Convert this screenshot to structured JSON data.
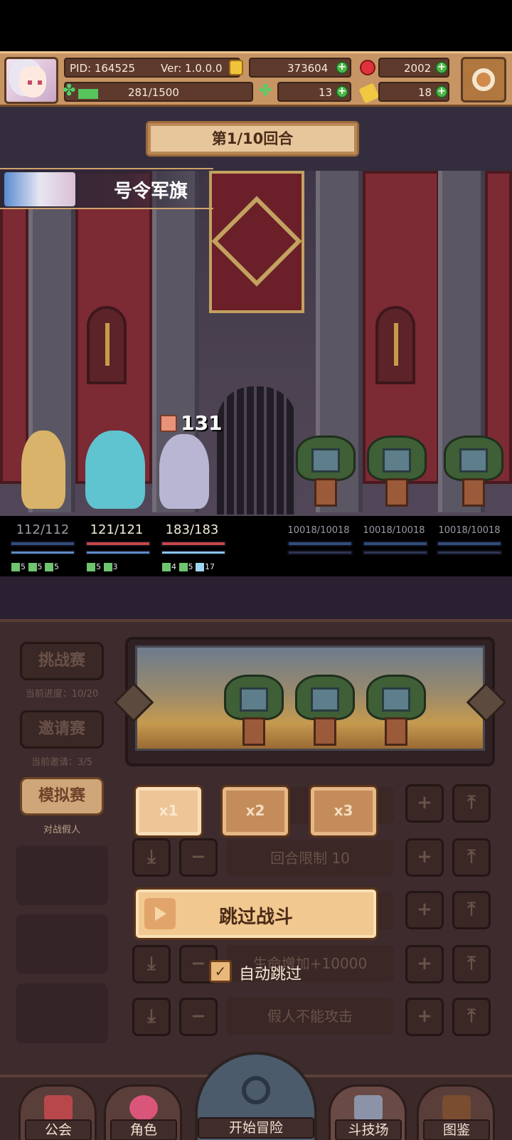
{
  "player": {
    "pid": "PID: 164525",
    "version": "Ver: 1.0.0.0",
    "energy": "281/1500",
    "energy_fraction": 0.187,
    "gold": "373604",
    "gems": "2002",
    "clovers": "13",
    "tickets": "18"
  },
  "battle": {
    "round": "第1/10回合",
    "skill_name": "号令军旗",
    "damage_popup": "131",
    "allies": [
      {
        "hp": "112/112",
        "buffs": [
          "5",
          "5",
          "5"
        ]
      },
      {
        "hp": "121/121",
        "buffs": [
          "5",
          "3"
        ]
      },
      {
        "hp": "183/183",
        "buffs": [
          "4",
          "5",
          "17"
        ]
      }
    ],
    "enemies": [
      {
        "hp": "10018/10018"
      },
      {
        "hp": "10018/10018"
      },
      {
        "hp": "10018/10018"
      }
    ]
  },
  "arena": {
    "modes": [
      {
        "label": "挑战赛",
        "caption": "当前进度：10/20"
      },
      {
        "label": "邀请赛",
        "caption": "当前邀请：3/5"
      },
      {
        "label": "模拟赛",
        "caption": "对战假人"
      }
    ],
    "speed_buttons": [
      "x1",
      "x2",
      "x3"
    ],
    "rows": [
      "",
      "回合限制 10",
      "",
      "生命增加+10000",
      "假人不能攻击"
    ],
    "skip_label": "跳过战斗",
    "auto_skip_label": "自动跳过",
    "auto_skip_checked": true
  },
  "nav": {
    "items": [
      "公会",
      "角色",
      "开始冒险",
      "斗技场",
      "图鉴"
    ]
  },
  "colors": {
    "accent": "#c79563",
    "panel": "#3e2b2d",
    "hp_red": "#c7474a",
    "mp_blue": "#5f8cc6"
  }
}
